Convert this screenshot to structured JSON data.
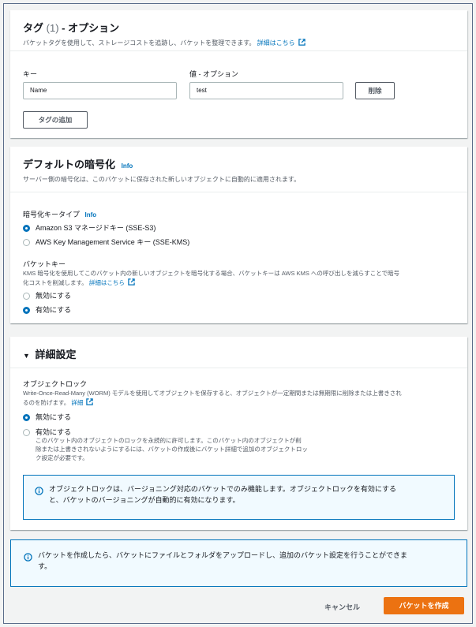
{
  "tags": {
    "title": "タグ",
    "count": "(1)",
    "title_suffix": " - オプション",
    "description": "バケットタグを使用して、ストレージコストを追跡し、バケットを整理できます。",
    "learn_more": "詳細はこちら",
    "key_label": "キー",
    "value_label": "値 - オプション",
    "key_value": "Name",
    "value_value": "test",
    "remove_button": "削除",
    "add_tag_button": "タグの追加"
  },
  "encryption": {
    "title": "デフォルトの暗号化",
    "info": "Info",
    "description": "サーバー側の暗号化は、このバケットに保存された新しいオブジェクトに自動的に適用されます。",
    "key_type_label": "暗号化キータイプ",
    "key_type_info": "Info",
    "option_sse_s3": "Amazon S3 マネージドキー (SSE-S3)",
    "option_sse_kms": "AWS Key Management Service キー (SSE-KMS)",
    "bucket_key_label": "バケットキー",
    "bucket_key_desc_1": "KMS 暗号化を使用してこのバケット内の新しいオブジェクトを暗号化する場合、バケットキーは AWS KMS への呼び出しを減らすことで暗号",
    "bucket_key_desc_2": "化コストを削減します。",
    "bucket_key_learn_more": "詳細はこちら",
    "disable": "無効にする",
    "enable": "有効にする"
  },
  "advanced": {
    "title": "詳細設定",
    "object_lock_label": "オブジェクトロック",
    "object_lock_desc_1": "Write-Once-Read-Many (WORM) モデルを使用してオブジェクトを保存すると、オブジェクトが一定期間または無期限に削除または上書きされ",
    "object_lock_desc_2": "るのを防げます。",
    "object_lock_learn_more": "詳細",
    "disable": "無効にする",
    "enable": "有効にする",
    "enable_desc_1": "このバケット内のオブジェクトのロックを永続的に許可します。このバケット内のオブジェクトが削",
    "enable_desc_2": "除または上書きされないようにするには、バケットの作成後にバケット詳細で追加のオブジェクトロッ",
    "enable_desc_3": "ク設定が必要です。",
    "alert_1": "オブジェクトロックは、バージョニング対応のバケットでのみ機能します。オブジェクトロックを有効にする",
    "alert_2": "と、バケットのバージョニングが自動的に有効になります。"
  },
  "footer": {
    "info_1": "バケットを作成したら、バケットにファイルとフォルダをアップロードし、追加のバケット設定を行うことができま",
    "info_2": "す。",
    "cancel_button": "キャンセル",
    "create_button": "バケットを作成"
  },
  "colors": {
    "accent": "#0073bb",
    "primary_button": "#ec7211",
    "info_alert_bg": "#f1faff"
  }
}
